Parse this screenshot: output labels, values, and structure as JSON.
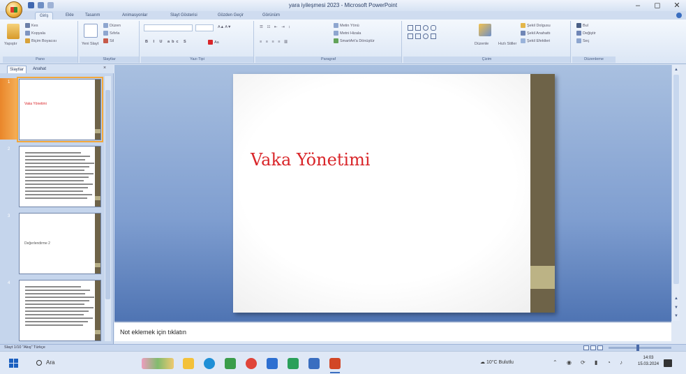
{
  "window": {
    "title": "yara iyileşmesi 2023 - Microsoft PowerPoint",
    "controls": {
      "minimize": "–",
      "maximize": "◻",
      "close": "✕"
    }
  },
  "ribbon_tabs": [
    "Giriş",
    "Ekle",
    "Tasarım",
    "Animasyonlar",
    "Slayt Gösterisi",
    "Gözden Geçir",
    "Görünüm"
  ],
  "ribbon_groups": [
    "Pano",
    "Slaytlar",
    "Yazı Tipi",
    "Paragraf",
    "Çizim",
    "Düzenleme"
  ],
  "ribbon_buttons": {
    "paste": "Yapıştır",
    "cut": "Kes",
    "copy": "Kopyala",
    "format_painter": "Biçim Boyacısı",
    "new_slide": "Yeni Slayt",
    "layout": "Düzen",
    "reset": "Sıfırla",
    "delete": "Sil",
    "text_direction": "Metin Yönü",
    "align_text": "Metni Hizala",
    "smartart": "SmartArt'a Dönüştür",
    "arrange": "Düzenle",
    "quick_styles": "Hızlı Stiller",
    "shape_fill": "Şekil Dolgusu",
    "shape_outline": "Şekil Anahattı",
    "shape_effects": "Şekil Efektleri",
    "find": "Bul",
    "replace": "Değiştir",
    "select": "Seç"
  },
  "left_pane": {
    "tabs": [
      "Slaytlar",
      "Anahat"
    ],
    "close": "×",
    "thumbnails": [
      {
        "number": "1",
        "title": "Vaka Yönetimi",
        "title_color": "#d9262a",
        "lines": 0
      },
      {
        "number": "2",
        "title": "",
        "lines": 14
      },
      {
        "number": "3",
        "title": "Değerlendirme 2",
        "title_color": "#555555",
        "lines": 0
      },
      {
        "number": "4",
        "title": "",
        "lines": 12
      }
    ]
  },
  "slide": {
    "title": "Vaka Yönetimi",
    "title_color": "#d9262a",
    "bar_color": "#6e6348",
    "accent_color": "#bcb385"
  },
  "notes": {
    "placeholder": "Not eklemek için tıklatın"
  },
  "status": {
    "left": "Slayt 1/10   \"Akış\"   Türkçe"
  },
  "taskbar": {
    "search_label": "Ara",
    "apps": [
      {
        "name": "file-explorer-icon",
        "color": "#f3c13a"
      },
      {
        "name": "edge-icon",
        "color": "#1f8fd6"
      },
      {
        "name": "chrome-icon",
        "color": "#3a9d4a"
      },
      {
        "name": "snip-icon",
        "color": "#e0453a"
      },
      {
        "name": "app-blue-icon",
        "color": "#2d6fd1"
      },
      {
        "name": "app-green-icon",
        "color": "#2aa05a"
      },
      {
        "name": "calculator-icon",
        "color": "#3a6ec0"
      },
      {
        "name": "powerpoint-icon",
        "color": "#d24726"
      }
    ],
    "weather": "10°C Bulutlu",
    "time": "14:03",
    "date": "15.03.2024"
  }
}
